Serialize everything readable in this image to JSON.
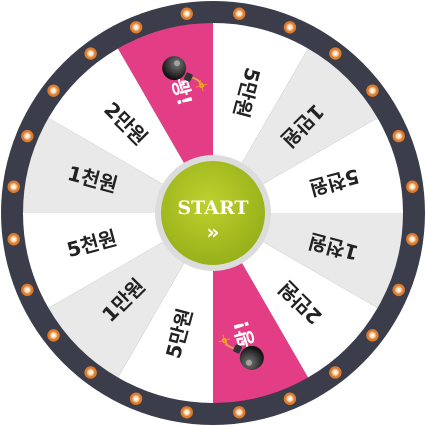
{
  "colors": {
    "rim": "#3b3d4a",
    "rim_dark": "#2a2b35",
    "bulb": "#f7d9b0",
    "bulb_core": "#ffffff",
    "bulb_glow": "#e07a2a",
    "segment_white": "#ffffff",
    "segment_grey": "#e9e9e9",
    "segment_pink": "#e33d86",
    "label_dark": "#222222",
    "label_light": "#ffffff",
    "hub_outer": "#dcdcdc",
    "hub": "#a4bc1e",
    "hub_inner": "#b5cb2a"
  },
  "wheel": {
    "segments": [
      {
        "label": "5만원",
        "bg": "white",
        "bomb": false
      },
      {
        "label": "1만원",
        "bg": "grey",
        "bomb": false
      },
      {
        "label": "5천원",
        "bg": "white",
        "bomb": false
      },
      {
        "label": "1천원",
        "bg": "grey",
        "bomb": false
      },
      {
        "label": "2만원",
        "bg": "white",
        "bomb": false
      },
      {
        "label": "꽝!",
        "bg": "pink",
        "bomb": true
      },
      {
        "label": "5만원",
        "bg": "white",
        "bomb": false
      },
      {
        "label": "1만원",
        "bg": "grey",
        "bomb": false
      },
      {
        "label": "5천원",
        "bg": "white",
        "bomb": false
      },
      {
        "label": "1천원",
        "bg": "grey",
        "bomb": false
      },
      {
        "label": "2만원",
        "bg": "white",
        "bomb": false
      },
      {
        "label": "꽝!",
        "bg": "pink",
        "bomb": true
      }
    ],
    "bulb_count": 24,
    "icons": {
      "bomb": "bomb-icon",
      "arrow": "double-chevron-right-icon"
    }
  },
  "start_button": {
    "label": "START",
    "arrow": "»"
  }
}
